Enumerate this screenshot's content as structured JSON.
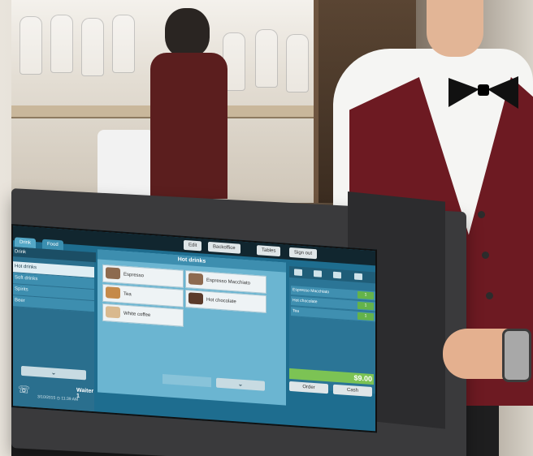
{
  "pos": {
    "top_buttons": [
      "Edit",
      "Backoffice",
      "Tables",
      "Sign out"
    ],
    "tabs": [
      "Drink",
      "Food"
    ],
    "left": {
      "header": "Drink",
      "items": [
        "Hot drinks",
        "Soft drinks",
        "Spirits",
        "Beer"
      ],
      "down_label": "⌄",
      "waiter": "Waiter 1",
      "date": "3/10/2015",
      "time": "11:39 AM"
    },
    "middle": {
      "header": "Hot drinks",
      "products": [
        "Espresso",
        "Espresso Macchiato",
        "Tea",
        "Hot chocolate",
        "White coffee"
      ],
      "down_label": "⌄"
    },
    "order": {
      "items": [
        {
          "name": "Espresso Macchiato",
          "qty": "1"
        },
        {
          "name": "Hot chocolate",
          "qty": "1"
        },
        {
          "name": "Tea",
          "qty": "1"
        }
      ],
      "total": "$9.00",
      "buttons": [
        "Order",
        "Cash"
      ]
    }
  },
  "colors": {
    "screen_bg": "#1e6d8f",
    "vest": "#6d1a22",
    "total_green": "#7cc354"
  },
  "icons": [
    "phone-icon",
    "user-icon",
    "clock-icon",
    "edit-icon",
    "wrench-icon"
  ]
}
